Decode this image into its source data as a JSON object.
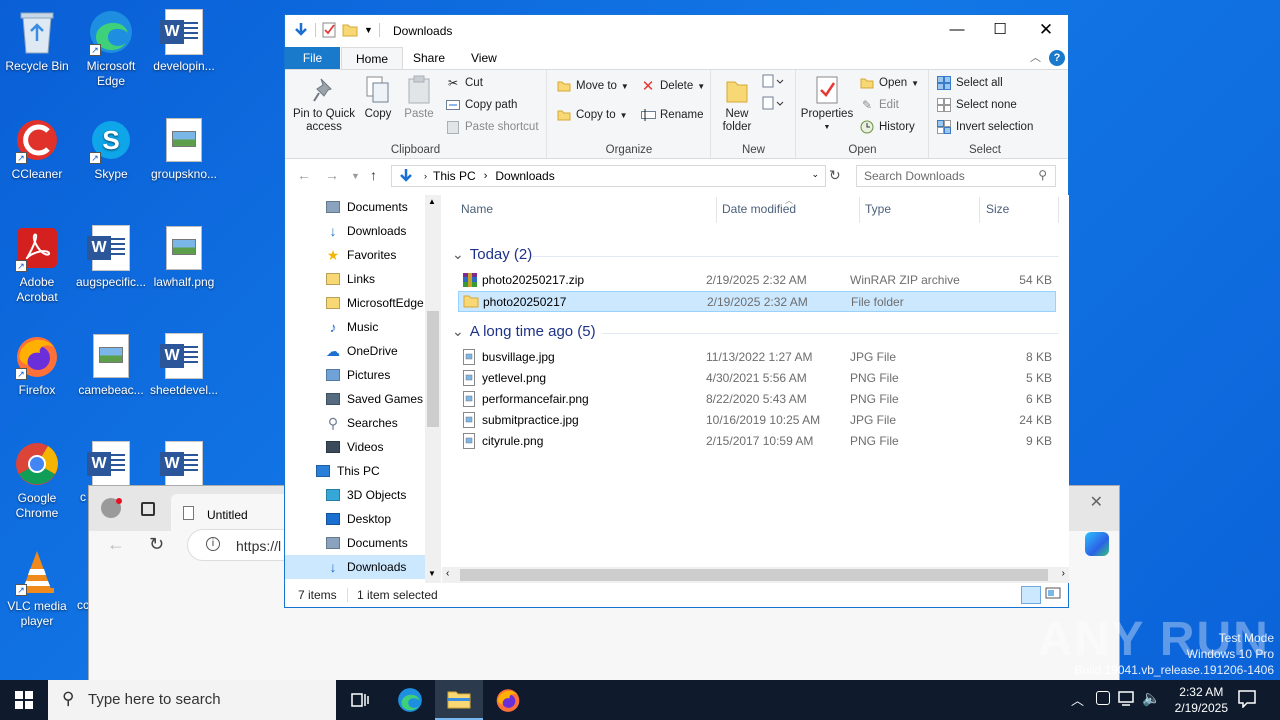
{
  "desktop": {
    "icons": [
      {
        "label": "Recycle Bin",
        "icon": "recycle-bin-icon"
      },
      {
        "label": "Microsoft Edge",
        "icon": "edge-icon"
      },
      {
        "label": "developin...",
        "icon": "word-doc-icon"
      },
      {
        "label": "CCleaner",
        "icon": "ccleaner-icon"
      },
      {
        "label": "Skype",
        "icon": "skype-icon"
      },
      {
        "label": "groupskno...",
        "icon": "image-file-icon"
      },
      {
        "label": "Adobe Acrobat",
        "icon": "acrobat-icon"
      },
      {
        "label": "augspecific...",
        "icon": "word-doc-icon"
      },
      {
        "label": "lawhalf.png",
        "icon": "image-file-icon"
      },
      {
        "label": "Firefox",
        "icon": "firefox-icon"
      },
      {
        "label": "camebeac...",
        "icon": "image-file-icon"
      },
      {
        "label": "sheetdevel...",
        "icon": "word-doc-icon"
      },
      {
        "label": "Google Chrome",
        "icon": "chrome-icon"
      },
      {
        "label": "c",
        "icon": "word-doc-icon"
      },
      {
        "label": "VLC media player",
        "icon": "vlc-icon"
      },
      {
        "label": "cc",
        "icon": "word-doc-icon"
      }
    ]
  },
  "browser": {
    "tab_title": "Untitled",
    "address": "https://l"
  },
  "explorer": {
    "title": "Downloads",
    "tabs": {
      "file": "File",
      "home": "Home",
      "share": "Share",
      "view": "View"
    },
    "ribbon": {
      "clipboard": {
        "name": "Clipboard",
        "pin": "Pin to Quick access",
        "copy": "Copy",
        "paste": "Paste",
        "cut": "Cut",
        "copy_path": "Copy path",
        "paste_shortcut": "Paste shortcut"
      },
      "organize": {
        "name": "Organize",
        "move_to": "Move to",
        "copy_to": "Copy to",
        "delete": "Delete",
        "rename": "Rename"
      },
      "new": {
        "name": "New",
        "new_folder": "New folder"
      },
      "open": {
        "name": "Open",
        "properties": "Properties",
        "open": "Open",
        "edit": "Edit",
        "history": "History"
      },
      "select": {
        "name": "Select",
        "select_all": "Select all",
        "select_none": "Select none",
        "invert": "Invert selection"
      }
    },
    "address": {
      "crumbs": [
        "This PC",
        "Downloads"
      ],
      "search_placeholder": "Search Downloads"
    },
    "nav": [
      {
        "label": "Documents",
        "icon": "documents-icon"
      },
      {
        "label": "Downloads",
        "icon": "downloads-icon"
      },
      {
        "label": "Favorites",
        "icon": "favorites-icon"
      },
      {
        "label": "Links",
        "icon": "links-icon"
      },
      {
        "label": "MicrosoftEdge",
        "icon": "folder-icon"
      },
      {
        "label": "Music",
        "icon": "music-icon"
      },
      {
        "label": "OneDrive",
        "icon": "onedrive-icon"
      },
      {
        "label": "Pictures",
        "icon": "pictures-icon"
      },
      {
        "label": "Saved Games",
        "icon": "saved-games-icon"
      },
      {
        "label": "Searches",
        "icon": "searches-icon"
      },
      {
        "label": "Videos",
        "icon": "videos-icon"
      },
      {
        "label": "This PC",
        "icon": "this-pc-icon"
      },
      {
        "label": "3D Objects",
        "icon": "3d-objects-icon"
      },
      {
        "label": "Desktop",
        "icon": "desktop-icon"
      },
      {
        "label": "Documents",
        "icon": "documents-icon"
      },
      {
        "label": "Downloads",
        "icon": "downloads-icon",
        "selected": true
      }
    ],
    "columns": {
      "name": "Name",
      "date": "Date modified",
      "type": "Type",
      "size": "Size"
    },
    "groups": [
      {
        "header": "Today (2)",
        "files": [
          {
            "name": "photo20250217.zip",
            "date": "2/19/2025 2:32 AM",
            "type": "WinRAR ZIP archive",
            "size": "54 KB",
            "icon": "winrar-icon"
          },
          {
            "name": "photo20250217",
            "date": "2/19/2025 2:32 AM",
            "type": "File folder",
            "size": "",
            "icon": "folder-icon",
            "selected": true
          }
        ]
      },
      {
        "header": "A long time ago (5)",
        "files": [
          {
            "name": "busvillage.jpg",
            "date": "11/13/2022 1:27 AM",
            "type": "JPG File",
            "size": "8 KB",
            "icon": "image-file-icon"
          },
          {
            "name": "yetlevel.png",
            "date": "4/30/2021 5:56 AM",
            "type": "PNG File",
            "size": "5 KB",
            "icon": "image-file-icon"
          },
          {
            "name": "performancefair.png",
            "date": "8/22/2020 5:43 AM",
            "type": "PNG File",
            "size": "6 KB",
            "icon": "image-file-icon"
          },
          {
            "name": "submitpractice.jpg",
            "date": "10/16/2019 10:25 AM",
            "type": "JPG File",
            "size": "24 KB",
            "icon": "image-file-icon"
          },
          {
            "name": "cityrule.png",
            "date": "2/15/2017 10:59 AM",
            "type": "PNG File",
            "size": "9 KB",
            "icon": "image-file-icon"
          }
        ]
      }
    ],
    "status": {
      "count": "7 items",
      "selected": "1 item selected"
    }
  },
  "taskbar": {
    "search_placeholder": "Type here to search",
    "time": "2:32 AM",
    "date": "2/19/2025"
  },
  "watermark": {
    "line1": "Test Mode",
    "line2": "Windows 10 Pro",
    "line3": "Build 19041.vb_release.191206-1406",
    "brand": "ANY RUN"
  }
}
